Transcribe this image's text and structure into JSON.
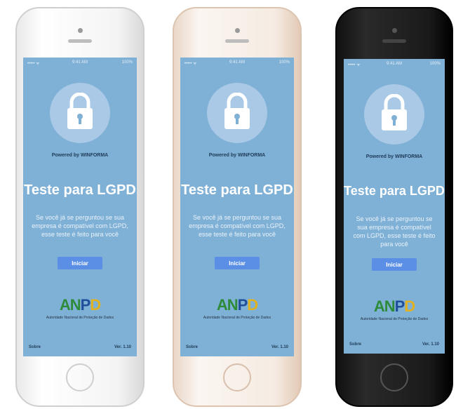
{
  "app": {
    "status_carrier": "••••• ᯤ",
    "status_time": "9:41 AM",
    "status_battery": "100%",
    "powered_by": "Powered by WINFORMA",
    "title": "Teste para LGPD",
    "description": "Se você já se perguntou se sua empresa é compatível com LGPD, esse teste é feito para você",
    "start_button": "Iniciar",
    "logo_text": [
      "AN",
      "P",
      "D"
    ],
    "logo_caption": "Autoridade Nacional de Proteção de Dados",
    "footer_left": "Sobre",
    "footer_right": "Ver. 1.10",
    "icon": "lock-icon"
  },
  "colors": {
    "screen_bg": "#7fb0d6",
    "button_bg": "#5b8fe6",
    "lock_circle": "#a9c9e6"
  },
  "phones": [
    "silver",
    "gold",
    "black"
  ]
}
